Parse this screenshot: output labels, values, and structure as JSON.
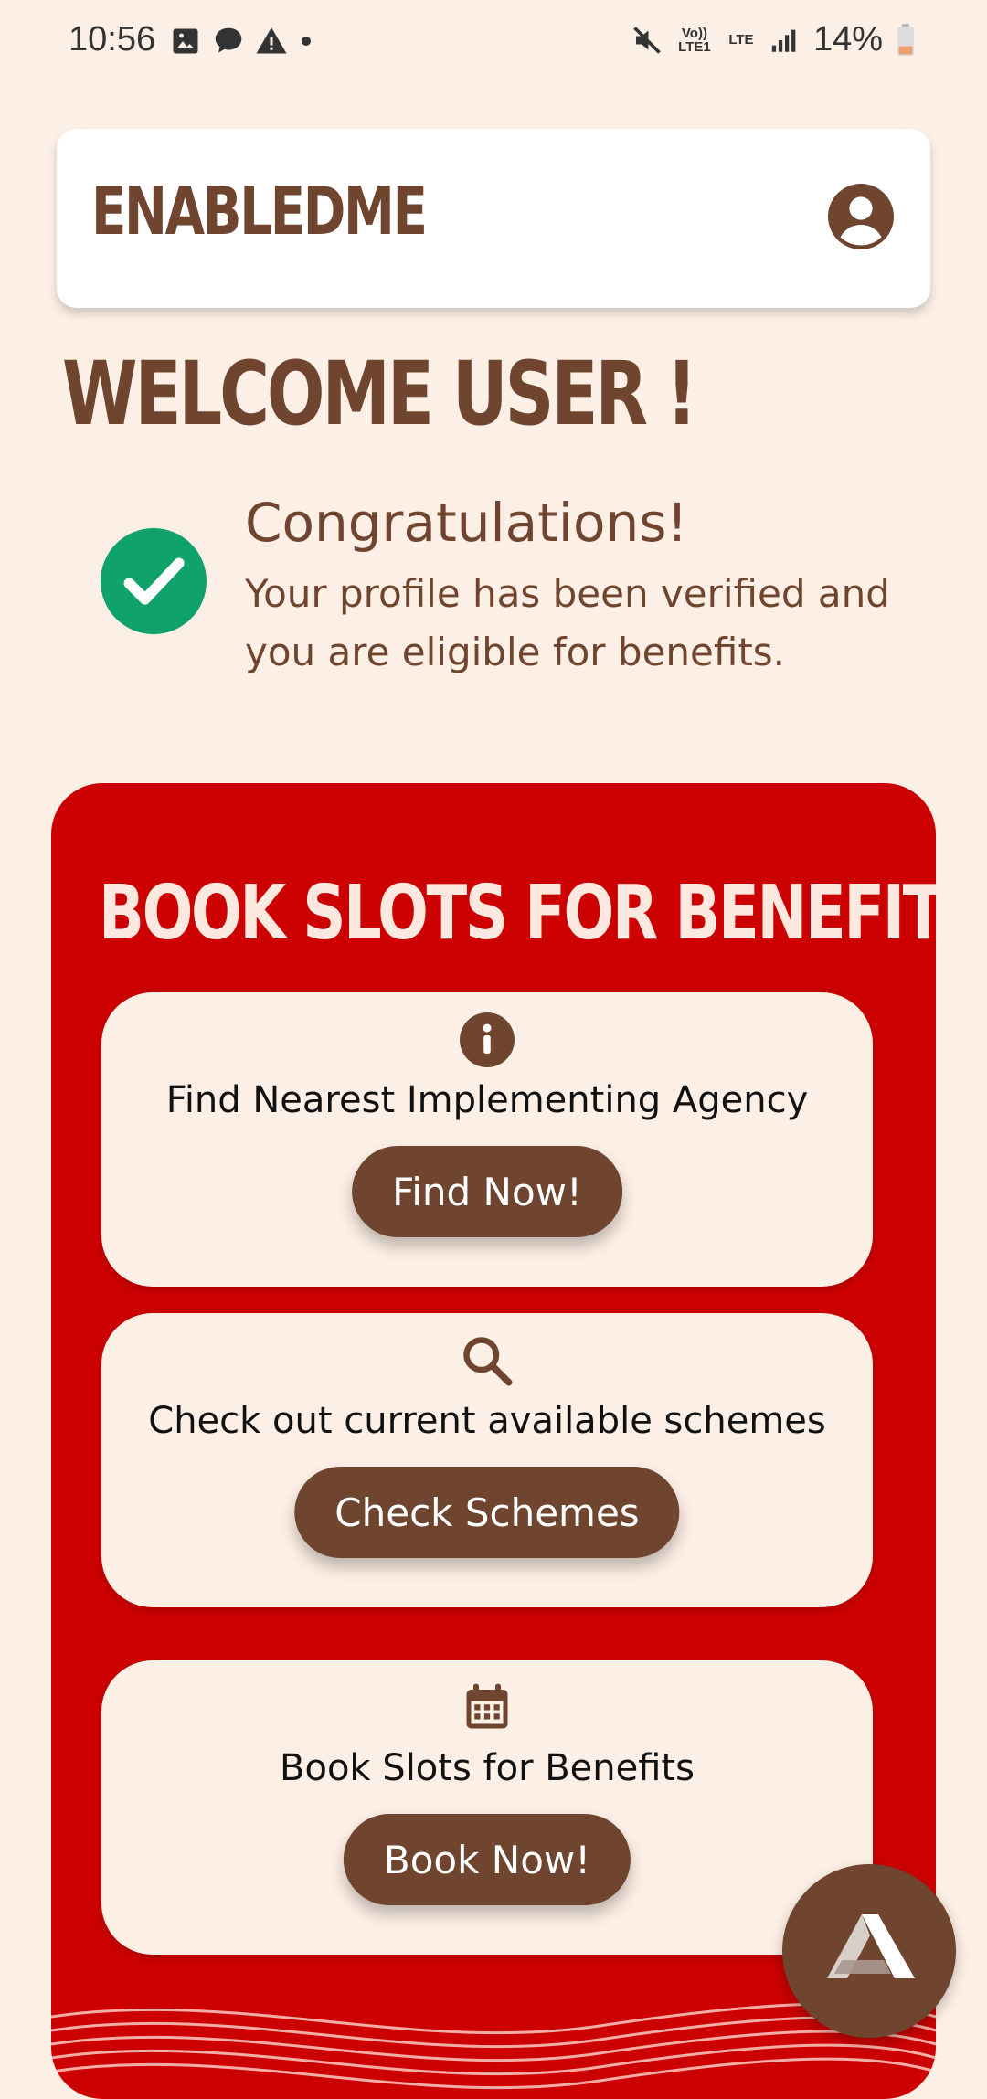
{
  "status_bar": {
    "time": "10:56",
    "battery_percent": "14%",
    "volte_label": "Vo)) LTE1",
    "lte_label": "LTE"
  },
  "header": {
    "logo": "ENABLEDME"
  },
  "welcome": {
    "title": "WELCOME USER !"
  },
  "verification": {
    "title": "Congratulations!",
    "message": "Your profile has been verified and you are eligible for benefits."
  },
  "benefits": {
    "title": "BOOK SLOTS FOR BENEFITS!",
    "cards": [
      {
        "icon": "info-icon",
        "text": "Find Nearest Implementing Agency",
        "button": "Find Now!"
      },
      {
        "icon": "search-icon",
        "text": "Check out current available schemes",
        "button": "Check Schemes"
      },
      {
        "icon": "calendar-icon",
        "text": "Book Slots for Benefits",
        "button": "Book Now!"
      }
    ]
  },
  "colors": {
    "brown": "#6f4530",
    "red_panel": "#cc0000",
    "cream": "#fcefe5",
    "check_green": "#0fa36b"
  }
}
